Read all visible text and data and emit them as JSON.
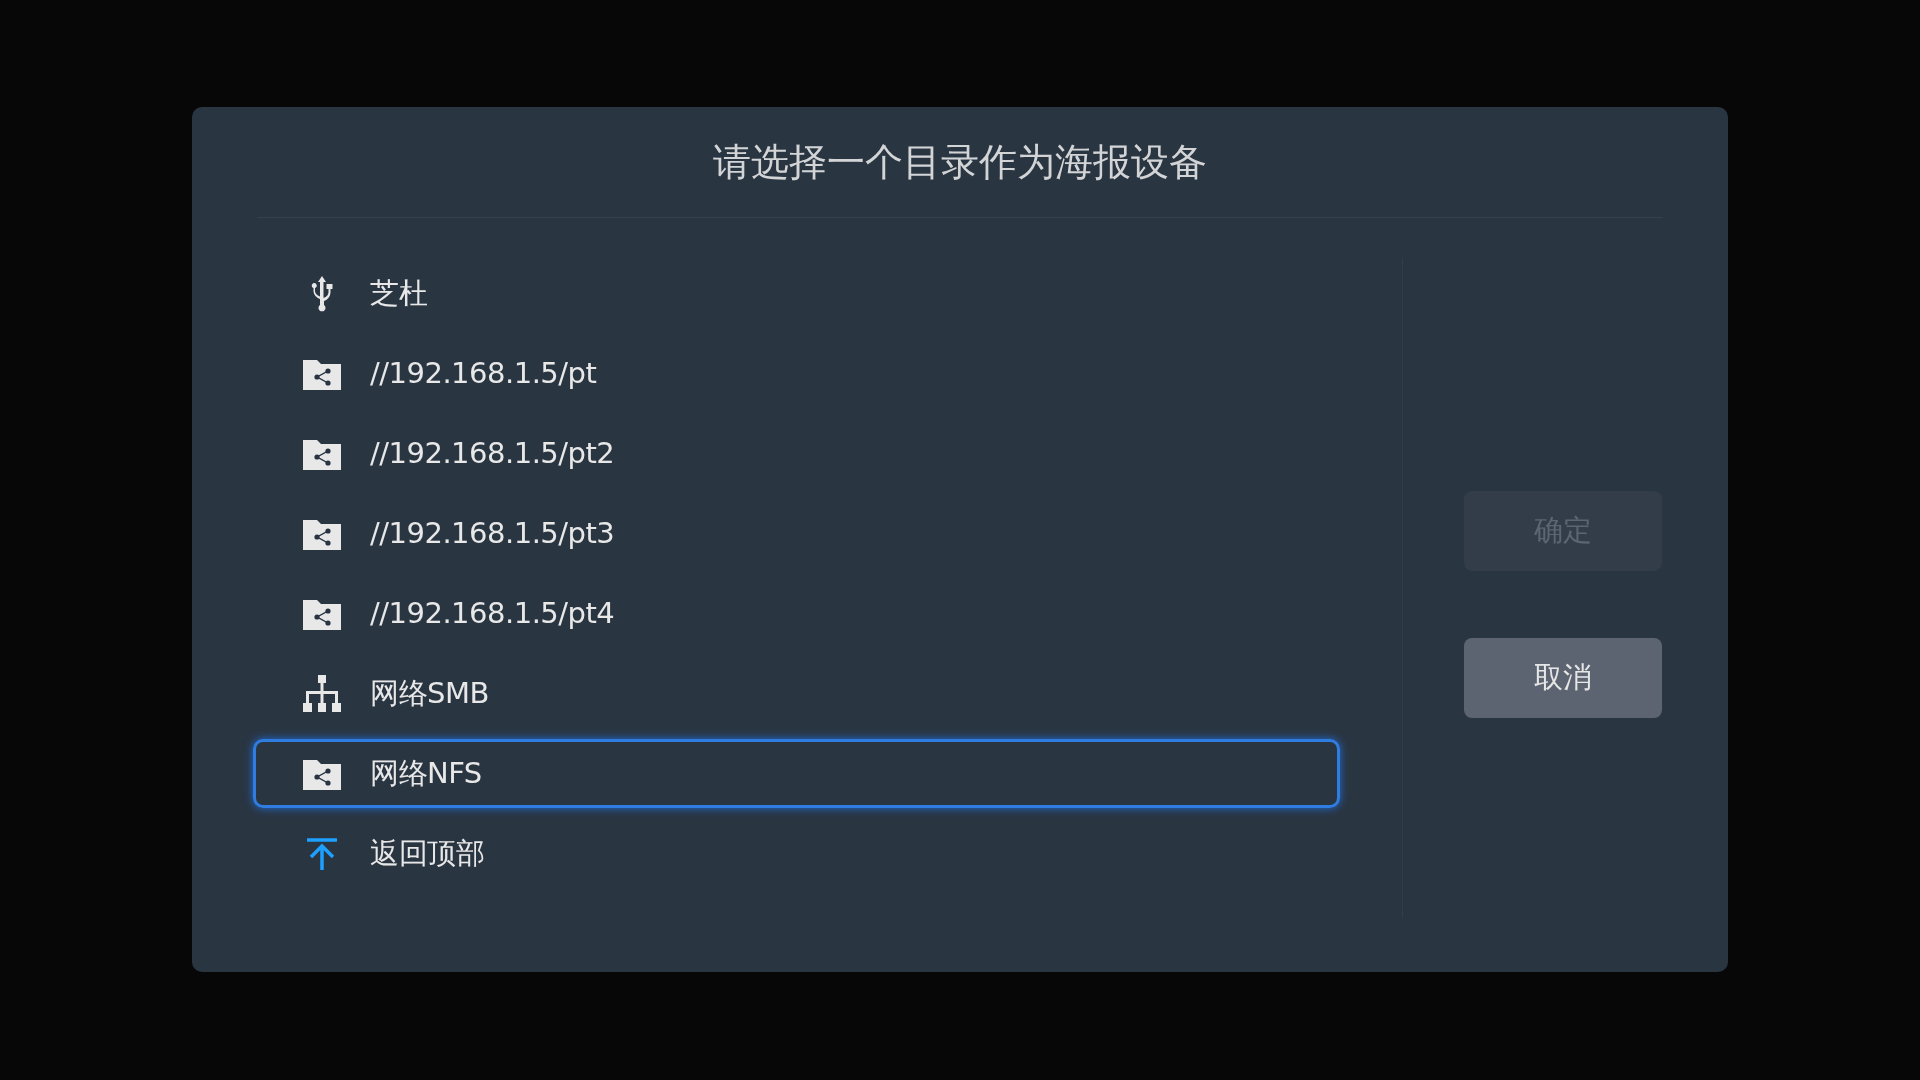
{
  "dialog": {
    "title": "请选择一个目录作为海报设备",
    "items": [
      {
        "label": "芝杜",
        "kind": "usb",
        "selected": false
      },
      {
        "label": "//192.168.1.5/pt",
        "kind": "share",
        "selected": false
      },
      {
        "label": "//192.168.1.5/pt2",
        "kind": "share",
        "selected": false
      },
      {
        "label": "//192.168.1.5/pt3",
        "kind": "share",
        "selected": false
      },
      {
        "label": "//192.168.1.5/pt4",
        "kind": "share",
        "selected": false
      },
      {
        "label": "网络SMB",
        "kind": "network",
        "selected": false
      },
      {
        "label": "网络NFS",
        "kind": "share",
        "selected": true
      },
      {
        "label": "返回顶部",
        "kind": "top",
        "selected": false
      }
    ],
    "buttons": [
      {
        "label": "确定",
        "disabled": true
      },
      {
        "label": "取消",
        "disabled": false
      }
    ]
  }
}
